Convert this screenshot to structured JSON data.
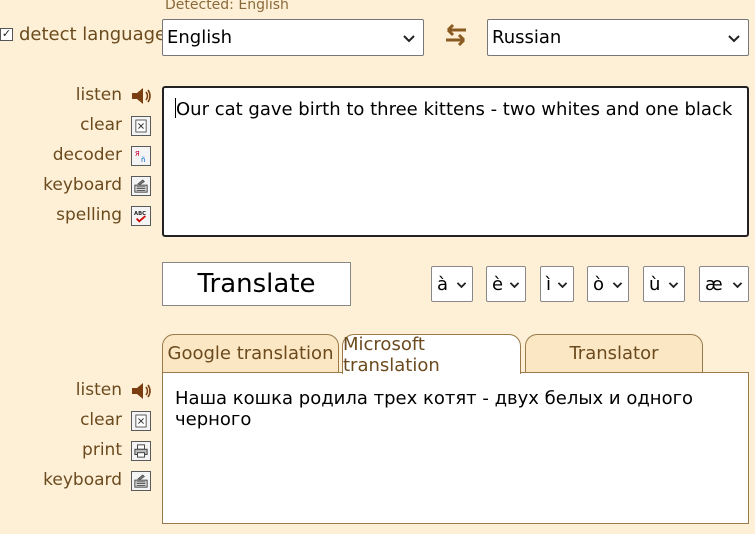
{
  "detected_text": "Detected: English",
  "detect_language": {
    "label": "detect language",
    "checked": true
  },
  "source_language": "English",
  "target_language": "Russian",
  "input_tools": {
    "listen": "listen",
    "clear": "clear",
    "decoder": "decoder",
    "keyboard": "keyboard",
    "spelling": "spelling"
  },
  "input_text": "Our cat gave birth to three kittens - two whites and one black",
  "translate_label": "Translate",
  "special_chars": [
    "à",
    "è",
    "ì",
    "ò",
    "ù",
    "æ"
  ],
  "tabs": [
    "Google translation",
    "Microsoft translation",
    "Translator"
  ],
  "active_tab": "Microsoft translation",
  "output_tools": {
    "listen": "listen",
    "clear": "clear",
    "print": "print",
    "keyboard": "keyboard"
  },
  "output_text": "Наша кошка родила трех котят - двух белых и одного черного",
  "colors": {
    "background": "#fdf0d6",
    "label": "#6b4a1e",
    "tab": "#fbe7c4"
  }
}
